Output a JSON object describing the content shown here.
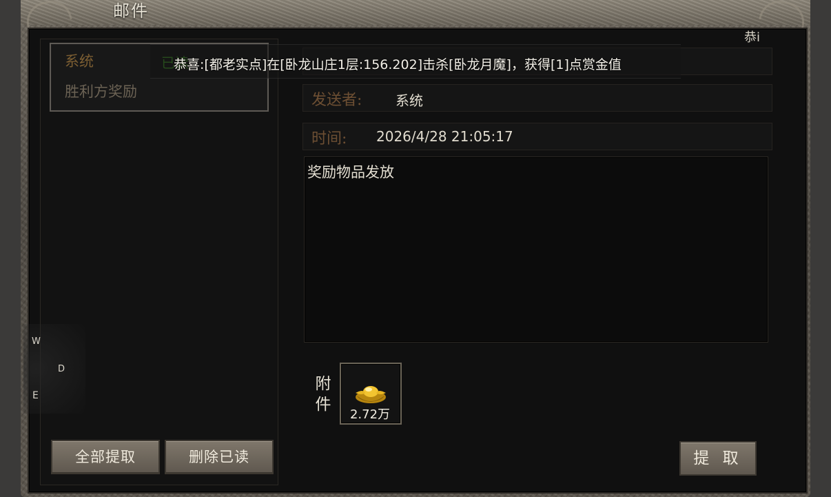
{
  "window": {
    "title": "邮件"
  },
  "mail_list": {
    "items": [
      {
        "label": "系统"
      },
      {
        "label": "胜利方奖励"
      }
    ],
    "tag": "已读",
    "buttons": {
      "collect_all": "全部提取",
      "delete_read": "删除已读"
    }
  },
  "mail_detail": {
    "sender_label": "发送者:",
    "sender_value": "系统",
    "time_label": "时间:",
    "time_value": "2026/4/28 21:05:17",
    "body": "奖励物品发放",
    "attachment_label": "附件",
    "attachment": {
      "icon": "gold-ingot-icon",
      "count": "2.72万"
    },
    "collect_button": "提 取"
  },
  "banner": {
    "text": "恭喜:[都老实点]在[卧龙山庄1层:156.202]击杀[卧龙月魔]，获得[1]点赏金值"
  },
  "corner_text": "恭i",
  "compass": {
    "w": "W",
    "d": "D",
    "e": "E"
  },
  "colors": {
    "label_brown": "#6d4f33",
    "list_highlight": "#7c5e32",
    "tag_green": "#3d8b26"
  }
}
